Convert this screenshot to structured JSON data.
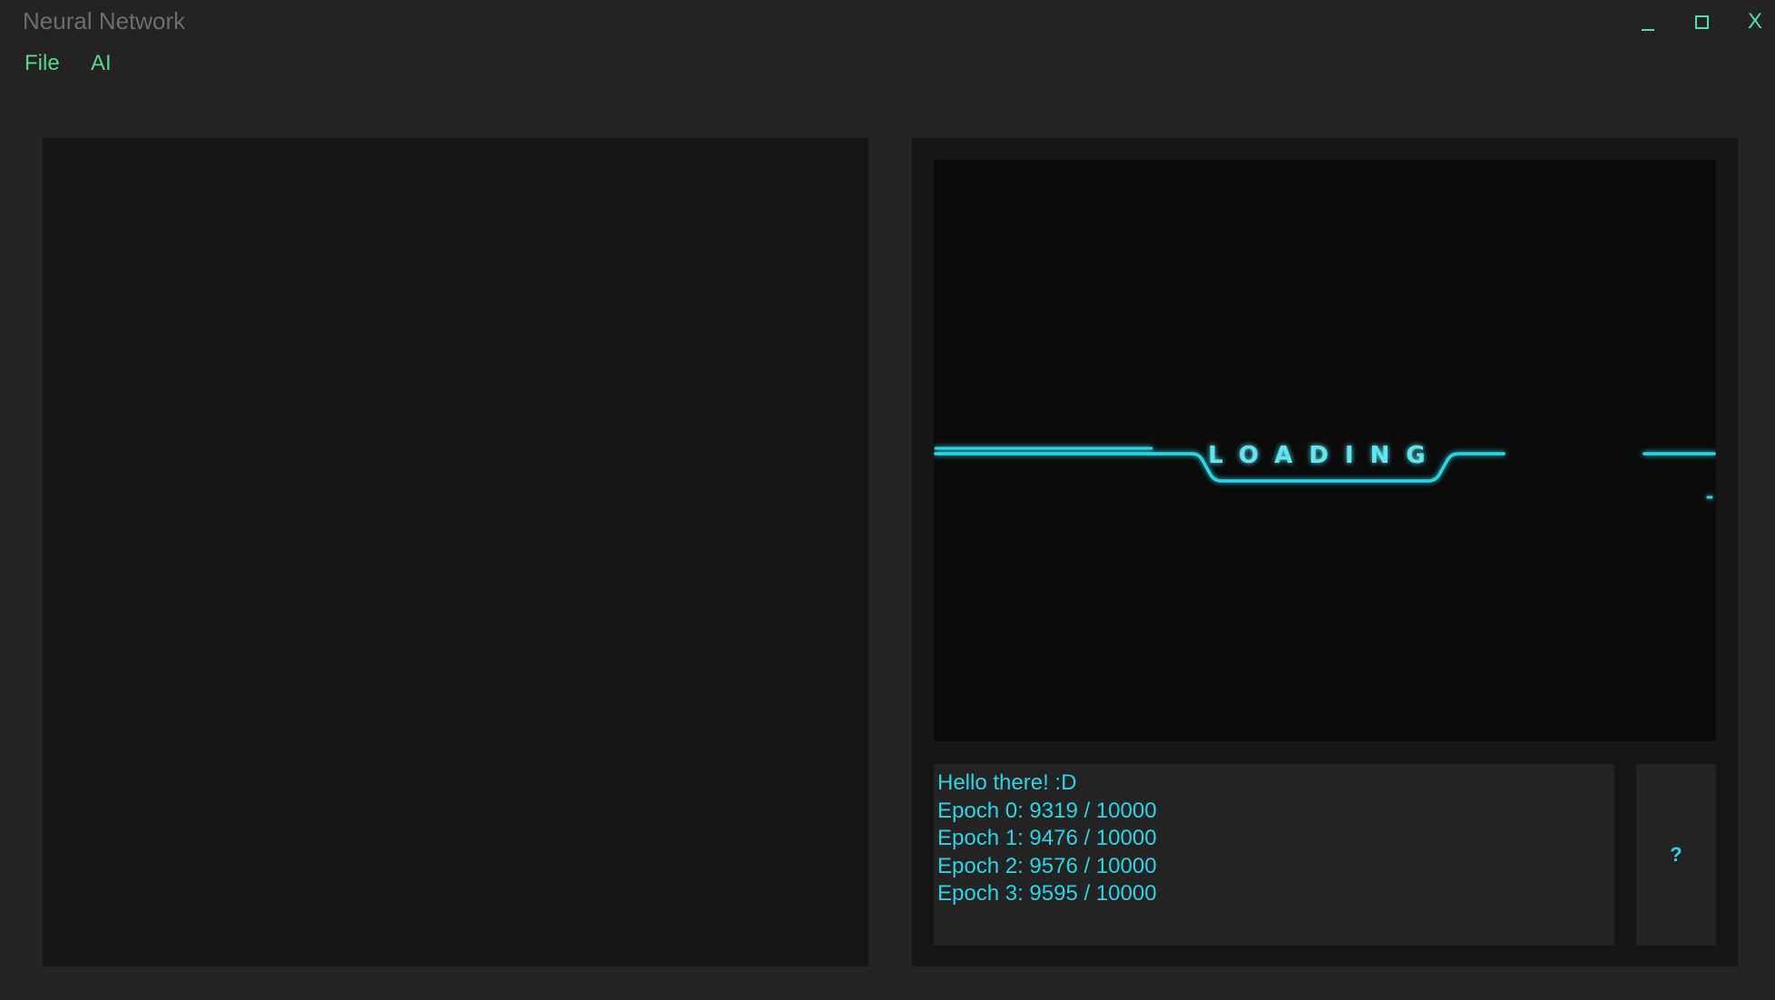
{
  "window": {
    "title": "Neural Network",
    "controls": {
      "minimize_icon": "minimize-icon",
      "maximize_icon": "maximize-icon",
      "close_label": "X"
    }
  },
  "menu": {
    "items": [
      {
        "label": "File"
      },
      {
        "label": "AI"
      }
    ]
  },
  "display": {
    "loading_text": "LOADING",
    "accent_color": "#29d6e6"
  },
  "log": {
    "lines": [
      "Hello there! :D",
      "Epoch 0: 9319 / 10000",
      "Epoch 1: 9476 / 10000",
      "Epoch 2: 9576 / 10000",
      "Epoch 3: 9595 / 10000"
    ]
  },
  "help_button": {
    "label": "?"
  },
  "colors": {
    "background": "#232323",
    "panel": "#161616",
    "menu_text": "#58d78a",
    "log_text": "#29d6e6"
  }
}
